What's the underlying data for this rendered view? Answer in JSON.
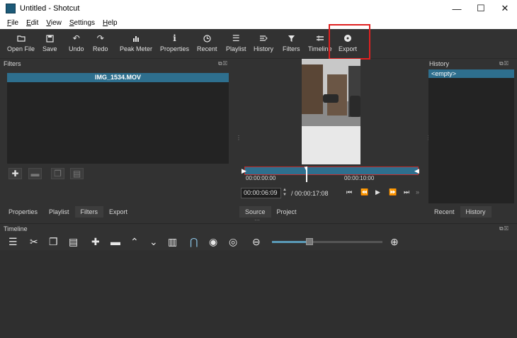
{
  "window": {
    "title": "Untitled - Shotcut",
    "controls": [
      "—",
      "☐",
      "✕"
    ]
  },
  "menu": [
    "File",
    "Edit",
    "View",
    "Settings",
    "Help"
  ],
  "toolbar": {
    "open_file": "Open File",
    "save": "Save",
    "undo": "Undo",
    "redo": "Redo",
    "peak_meter": "Peak Meter",
    "properties": "Properties",
    "recent": "Recent",
    "playlist": "Playlist",
    "history": "History",
    "filters": "Filters",
    "timeline": "Timeline",
    "export": "Export"
  },
  "filters": {
    "title": "Filters",
    "clip_name": "IMG_1534.MOV",
    "tabs": [
      "Properties",
      "Playlist",
      "Filters",
      "Export"
    ],
    "active_tab": "Filters"
  },
  "player": {
    "ruler_start": "00:00:00:00",
    "ruler_mark": "00:00:10:00",
    "position": "00:00:06:09",
    "duration": "/ 00:00:17:08",
    "tabs": [
      "Source",
      "Project"
    ],
    "active_tab": "Source"
  },
  "history": {
    "title": "History",
    "item": "<empty>",
    "tabs": [
      "Recent",
      "History"
    ],
    "active_tab": "History"
  },
  "timeline": {
    "title": "Timeline",
    "zoom_fraction": 0.32
  },
  "colors": {
    "accent": "#2e6f8e",
    "highlight": "#e02020",
    "panel": "#323232"
  }
}
